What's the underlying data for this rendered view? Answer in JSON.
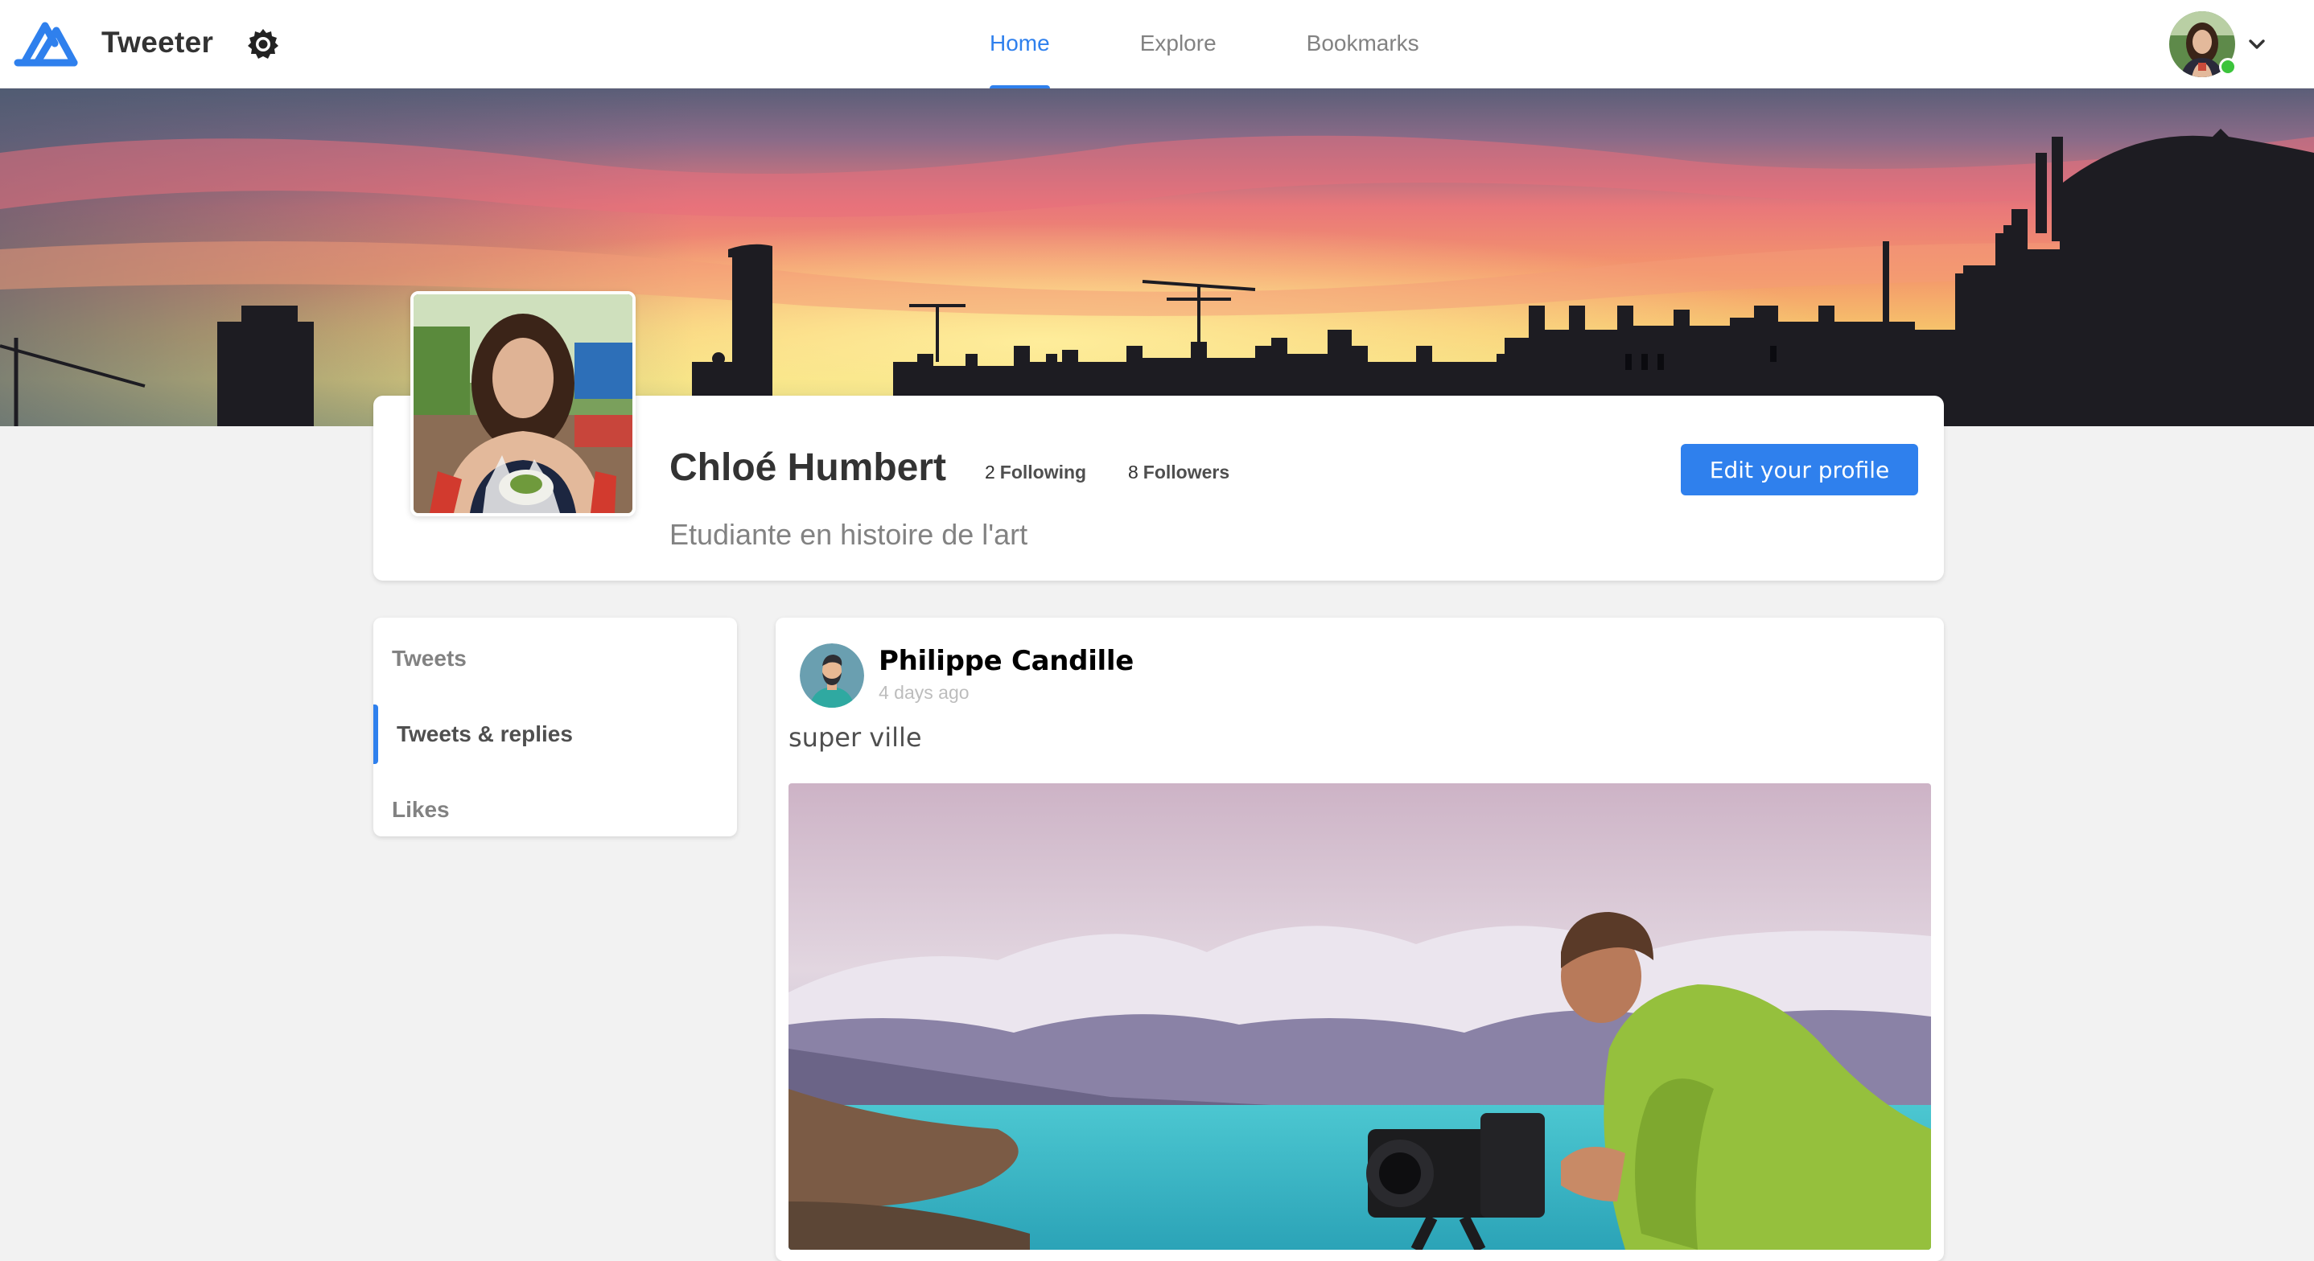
{
  "app": {
    "name": "Tweeter"
  },
  "icons": {
    "logo": "tweeter-logo",
    "theme": "gear-icon",
    "menu": "chevron-down-icon"
  },
  "nav": {
    "items": [
      {
        "label": "Home",
        "active": true
      },
      {
        "label": "Explore",
        "active": false
      },
      {
        "label": "Bookmarks",
        "active": false
      }
    ]
  },
  "user": {
    "status": "online"
  },
  "colors": {
    "accent": "#2F80ED",
    "online": "#3CC43C",
    "muted_text": "#828282"
  },
  "profile": {
    "name": "Chloé Humbert",
    "following_count": "2",
    "following_label": "Following",
    "followers_count": "8",
    "followers_label": "Followers",
    "bio": "Etudiante en histoire de l'art",
    "edit_label": "Edit your profile"
  },
  "filters": {
    "items": [
      {
        "label": "Tweets",
        "active": false
      },
      {
        "label": "Tweets & replies",
        "active": true
      },
      {
        "label": "Likes",
        "active": false
      }
    ]
  },
  "tweet": {
    "author": "Philippe Candille",
    "time": "4 days ago",
    "text": "super ville"
  }
}
